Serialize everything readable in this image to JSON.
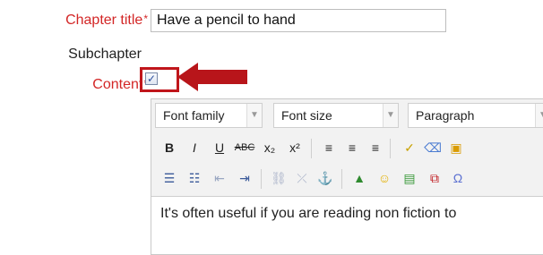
{
  "form": {
    "chapter_title_label": "Chapter title",
    "required_mark": "*",
    "chapter_title_value": "Have a pencil to hand",
    "subchapter_label": "Subchapter",
    "subchapter_checked": true,
    "content_label": "Content"
  },
  "editor": {
    "font_family": "Font family",
    "font_size": "Font size",
    "paragraph": "Paragraph",
    "body_text": "It's often useful if you are reading non fiction to"
  },
  "colors": {
    "required": "#d32626",
    "highlight": "#c0161b"
  },
  "icons": [
    "bold-icon",
    "italic-icon",
    "underline-icon",
    "strikethrough-icon",
    "subscript-icon",
    "superscript-icon",
    "align-left-icon",
    "align-center-icon",
    "align-right-icon",
    "spellcheck-icon",
    "eraser-icon",
    "bullet-list-icon",
    "numbered-list-icon",
    "outdent-icon",
    "indent-icon",
    "link-icon",
    "unlink-icon",
    "anchor-icon",
    "image-icon",
    "emoticon-icon",
    "media-icon",
    "file-icon"
  ]
}
